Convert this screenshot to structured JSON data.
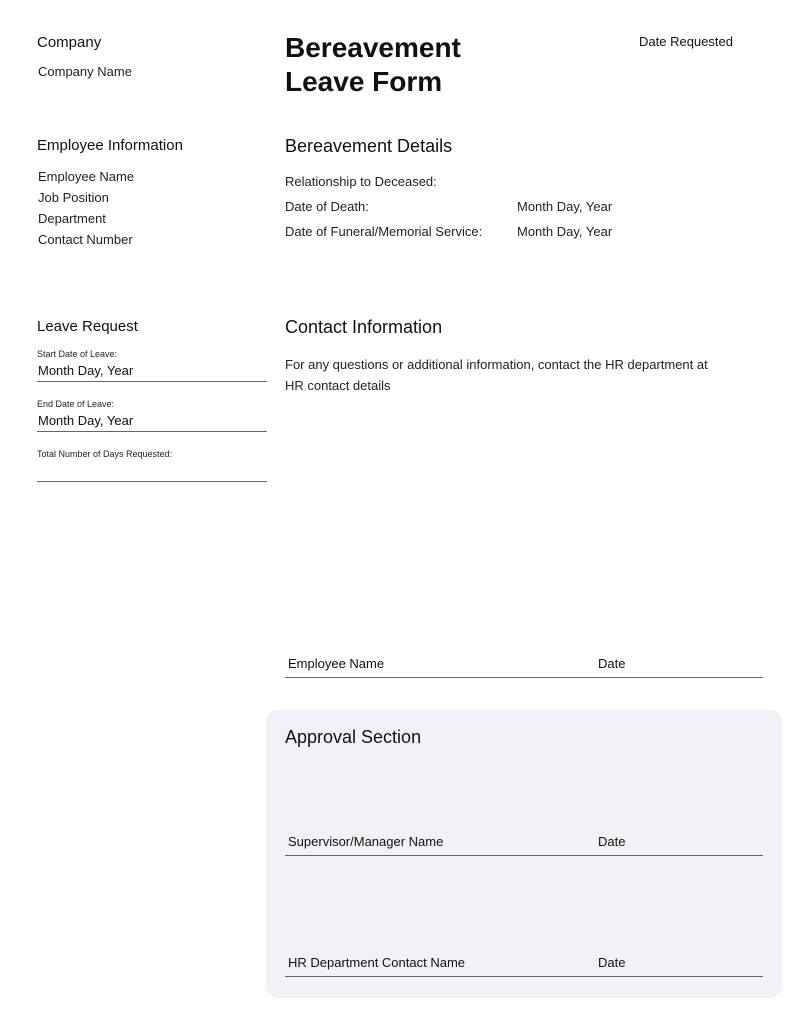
{
  "company": {
    "heading": "Company",
    "name": "Company Name"
  },
  "form": {
    "title_line1": "Bereavement",
    "title_line2": "Leave Form",
    "date_requested_label": "Date Requested"
  },
  "employee_info": {
    "heading": "Employee Information",
    "fields": [
      "Employee Name",
      "Job Position",
      "Department",
      "Contact Number"
    ]
  },
  "bereavement_details": {
    "heading": "Bereavement Details",
    "relationship_label": "Relationship to Deceased:",
    "relationship_value": "",
    "date_of_death_label": "Date of Death:",
    "date_of_death_value": "Month Day, Year",
    "funeral_label": "Date of Funeral/Memorial Service:",
    "funeral_value": "Month Day, Year"
  },
  "leave_request": {
    "heading": "Leave Request",
    "start_label": "Start Date of Leave:",
    "start_value": "Month Day, Year",
    "end_label": "End Date of Leave:",
    "end_value": "Month Day, Year",
    "total_label": "Total Number of Days Requested:",
    "total_value": ""
  },
  "contact_info": {
    "heading": "Contact Information",
    "text_line1": "For any questions or additional information, contact the HR department at",
    "text_line2": "HR contact details"
  },
  "employee_signature": {
    "name_label": "Employee Name",
    "date_label": "Date"
  },
  "approval": {
    "heading": "Approval Section",
    "supervisor_label": "Supervisor/Manager Name",
    "supervisor_date_label": "Date",
    "hr_label": "HR Department Contact Name",
    "hr_date_label": "Date",
    "background_color": "#f1f2f6"
  }
}
